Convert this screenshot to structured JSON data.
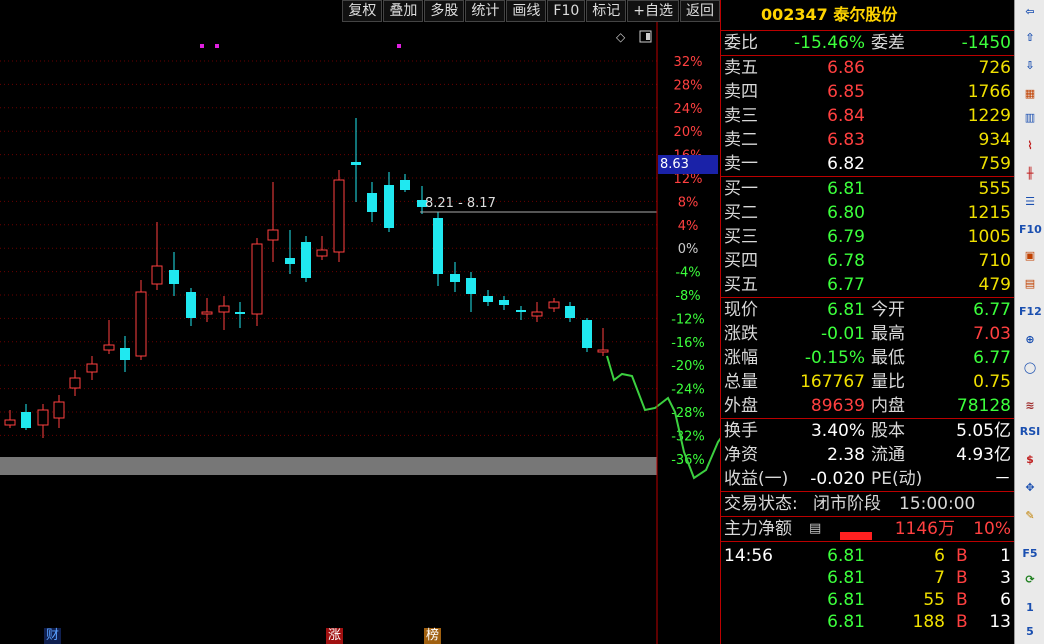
{
  "toolbar": {
    "buttons": [
      "复权",
      "叠加",
      "多股",
      "统计",
      "画线",
      "F10",
      "标记",
      "+自选",
      "返回"
    ]
  },
  "chart_data": {
    "type": "candlestick",
    "y_axis_labels": [
      "32%",
      "28%",
      "24%",
      "20%",
      "16%",
      "12%",
      "8%",
      "4%",
      "0%",
      "-4%",
      "-8%",
      "-12%",
      "-16%",
      "-20%",
      "-24%",
      "-28%",
      "-32%",
      "-36%"
    ],
    "current_price_label": "8.63",
    "range_annotation": "8.21 - 8.17",
    "bottom_tags": [
      "财",
      "涨",
      "榜"
    ]
  },
  "stock": {
    "code": "002347",
    "name": "泰尔股份"
  },
  "ratio": {
    "label1": "委比",
    "value1": "-15.46%",
    "label2": "委差",
    "value2": "-1450"
  },
  "sell": [
    {
      "label": "卖五",
      "price": "6.86",
      "vol": "726"
    },
    {
      "label": "卖四",
      "price": "6.85",
      "vol": "1766"
    },
    {
      "label": "卖三",
      "price": "6.84",
      "vol": "1229"
    },
    {
      "label": "卖二",
      "price": "6.83",
      "vol": "934"
    },
    {
      "label": "卖一",
      "price": "6.82",
      "vol": "759"
    }
  ],
  "buy": [
    {
      "label": "买一",
      "price": "6.81",
      "vol": "555"
    },
    {
      "label": "买二",
      "price": "6.80",
      "vol": "1215"
    },
    {
      "label": "买三",
      "price": "6.79",
      "vol": "1005"
    },
    {
      "label": "买四",
      "price": "6.78",
      "vol": "710"
    },
    {
      "label": "买五",
      "price": "6.77",
      "vol": "479"
    }
  ],
  "stats": [
    {
      "l1": "现价",
      "v1": "6.81",
      "l2": "今开",
      "v2": "6.77"
    },
    {
      "l1": "涨跌",
      "v1": "-0.01",
      "l2": "最高",
      "v2": "7.03"
    },
    {
      "l1": "涨幅",
      "v1": "-0.15%",
      "l2": "最低",
      "v2": "6.77"
    },
    {
      "l1": "总量",
      "v1": "167767",
      "l2": "量比",
      "v2": "0.75"
    },
    {
      "l1": "外盘",
      "v1": "89639",
      "l2": "内盘",
      "v2": "78128"
    }
  ],
  "stats2": [
    {
      "l1": "换手",
      "v1": "3.40%",
      "l2": "股本",
      "v2": "5.05亿"
    },
    {
      "l1": "净资",
      "v1": "2.38",
      "l2": "流通",
      "v2": "4.93亿"
    },
    {
      "l1": "收益(一)",
      "v1": "-0.020",
      "l2": "PE(动)",
      "v2": "－"
    }
  ],
  "trade_status": {
    "label": "交易状态:",
    "status": "闭市阶段",
    "time": "15:00:00"
  },
  "main_flow": {
    "label": "主力净额",
    "amount": "1146万",
    "pct": "10%"
  },
  "ticks": [
    {
      "time": "14:56",
      "price": "6.81",
      "vol": "6",
      "side": "B",
      "n": "1"
    },
    {
      "time": "",
      "price": "6.81",
      "vol": "7",
      "side": "B",
      "n": "3"
    },
    {
      "time": "",
      "price": "6.81",
      "vol": "55",
      "side": "B",
      "n": "6"
    },
    {
      "time": "",
      "price": "6.81",
      "vol": "188",
      "side": "B",
      "n": "13"
    }
  ],
  "sidebar": {
    "labels": [
      "F10",
      "F12",
      "RSI",
      "1",
      "5"
    ],
    "icons": [
      "arrow-left-icon",
      "arrow-up-icon",
      "arrow-down-icon",
      "chart-icon",
      "grid-icon",
      "line-icon",
      "candle-icon",
      "list-icon",
      "info-icon",
      "chart2-icon",
      "fund-icon",
      "compass-icon",
      "circle-icon",
      "wave-icon",
      "money-icon",
      "move-icon",
      "pencil-icon",
      "refresh-icon"
    ]
  }
}
